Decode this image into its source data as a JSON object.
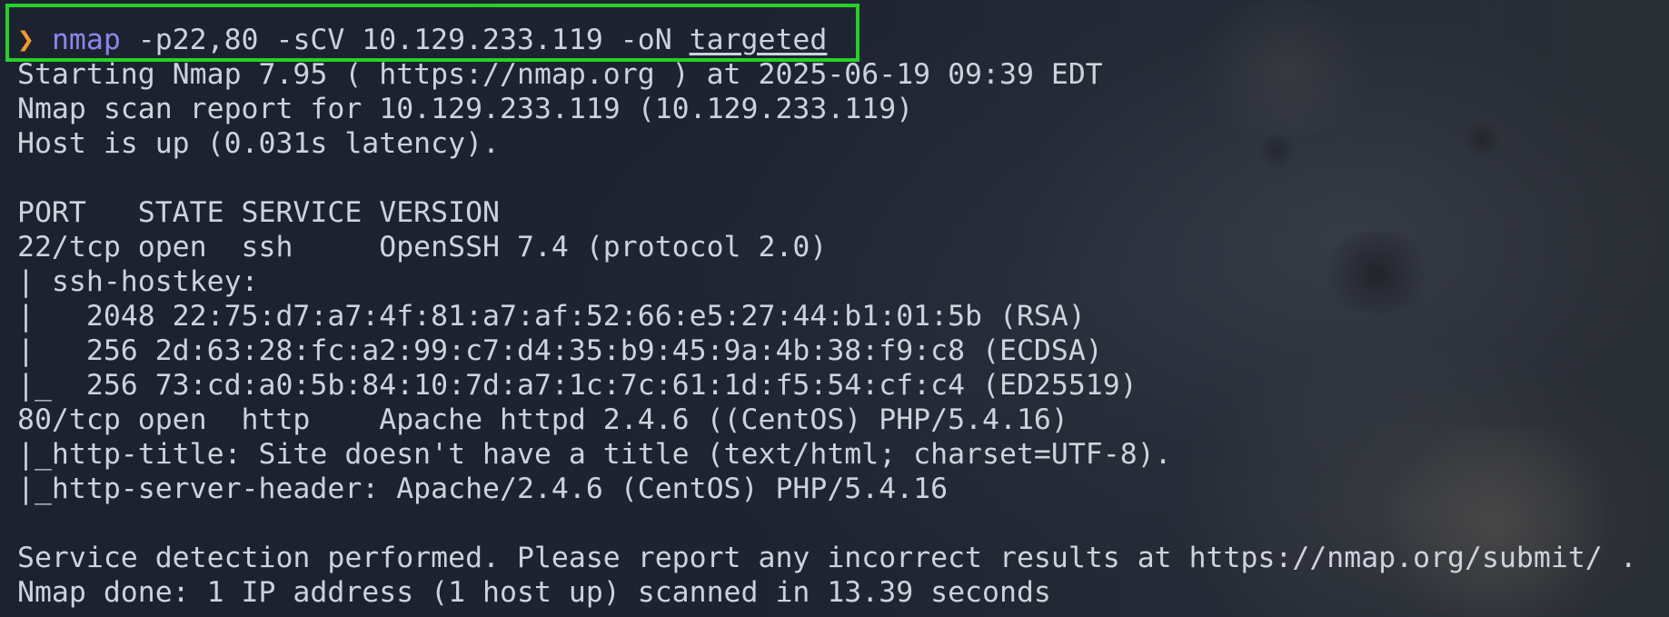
{
  "terminal": {
    "prompt": {
      "symbol": "❯",
      "command": "nmap",
      "args": " -p22,80 -sCV 10.129.233.119 -oN ",
      "output_file": "targeted"
    },
    "lines": [
      "Starting Nmap 7.95 ( https://nmap.org ) at 2025-06-19 09:39 EDT",
      "Nmap scan report for 10.129.233.119 (10.129.233.119)",
      "Host is up (0.031s latency).",
      "",
      "PORT   STATE SERVICE VERSION",
      "22/tcp open  ssh     OpenSSH 7.4 (protocol 2.0)",
      "| ssh-hostkey:",
      "|   2048 22:75:d7:a7:4f:81:a7:af:52:66:e5:27:44:b1:01:5b (RSA)",
      "|   256 2d:63:28:fc:a2:99:c7:d4:35:b9:45:9a:4b:38:f9:c8 (ECDSA)",
      "|_  256 73:cd:a0:5b:84:10:7d:a7:1c:7c:61:1d:f5:54:cf:c4 (ED25519)",
      "80/tcp open  http    Apache httpd 2.4.6 ((CentOS) PHP/5.4.16)",
      "|_http-title: Site doesn't have a title (text/html; charset=UTF-8).",
      "|_http-server-header: Apache/2.4.6 (CentOS) PHP/5.4.16",
      "",
      "Service detection performed. Please report any incorrect results at https://nmap.org/submit/ .",
      "Nmap done: 1 IP address (1 host up) scanned in 13.39 seconds"
    ]
  },
  "colors": {
    "highlight_border": "#27d028",
    "prompt_symbol": "#f39a2f",
    "command": "#8b86ea",
    "text": "#cfd2dc",
    "background": "#1f2430"
  }
}
